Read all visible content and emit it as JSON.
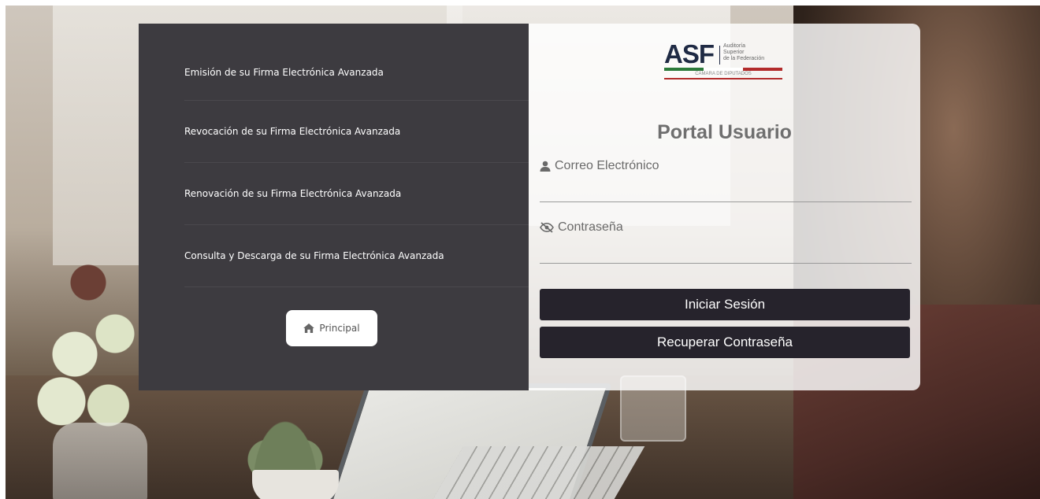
{
  "menu": {
    "items": [
      {
        "label": "Emisión de su Firma Electrónica Avanzada"
      },
      {
        "label": "Revocación de su Firma Electrónica Avanzada"
      },
      {
        "label": "Renovación de su Firma Electrónica Avanzada"
      },
      {
        "label": "Consulta y Descarga de su Firma Electrónica Avanzada"
      }
    ],
    "principal_label": "Principal"
  },
  "logo": {
    "acronym": "ASF",
    "sub1": "Auditoría",
    "sub2": "Superior",
    "sub3": "de la Federación",
    "caption": "CÁMARA DE DIPUTADOS"
  },
  "login": {
    "title": "Portal Usuario",
    "email_label": "Correo Electrónico",
    "email_value": "",
    "password_label": "Contraseña",
    "password_value": "",
    "login_button": "Iniciar Sesión",
    "recover_button": "Recuperar Contraseña"
  },
  "colors": {
    "panel_dark": "#3d3b40",
    "button_dark": "#26232c",
    "logo_navy": "#1f2a44",
    "flag_green": "#2c7a3a",
    "flag_red": "#b22b2b"
  },
  "icons": {
    "home": "home-icon",
    "user": "user-icon",
    "password_visibility": "eye-slash-icon"
  }
}
